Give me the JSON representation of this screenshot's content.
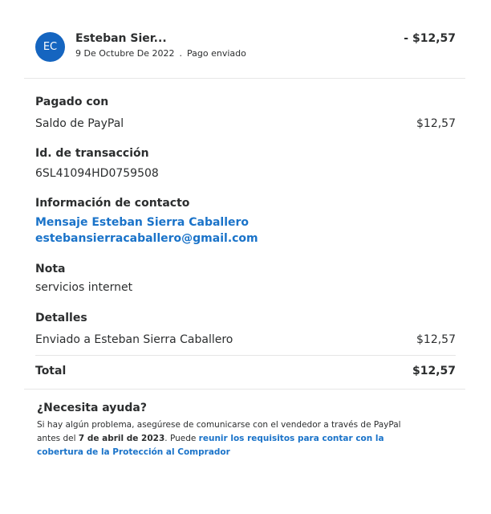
{
  "header": {
    "avatar_initials": "EC",
    "name": "Esteban Sier...",
    "date": "9 De Octubre De 2022",
    "separator": ".",
    "status": "Pago enviado",
    "amount": "- $12,57"
  },
  "paid_with": {
    "label": "Pagado con",
    "method": "Saldo de PayPal",
    "amount": "$12,57"
  },
  "transaction": {
    "label": "Id. de transacción",
    "id": "6SL41094HD0759508"
  },
  "contact": {
    "label": "Información de contacto",
    "message_link": "Mensaje Esteban Sierra Caballero",
    "email": "estebansierracaballero@gmail.com"
  },
  "note": {
    "label": "Nota",
    "text": "servicios internet"
  },
  "details": {
    "label": "Detalles",
    "line": "Enviado a Esteban Sierra Caballero",
    "amount": "$12,57"
  },
  "total": {
    "label": "Total",
    "amount": "$12,57"
  },
  "help": {
    "title": "¿Necesita ayuda?",
    "text_part1": "Si hay algún problema, asegúrese de comunicarse con el vendedor a través de PayPal antes del ",
    "deadline": "7 de abril de 2023",
    "text_part2": ". Puede ",
    "link": "reunir los requisitos para contar con la cobertura de la Protección al Comprador"
  },
  "colors": {
    "accent": "#1a73c9",
    "avatar_bg": "#1565c0",
    "divider": "#e6e6e6"
  }
}
